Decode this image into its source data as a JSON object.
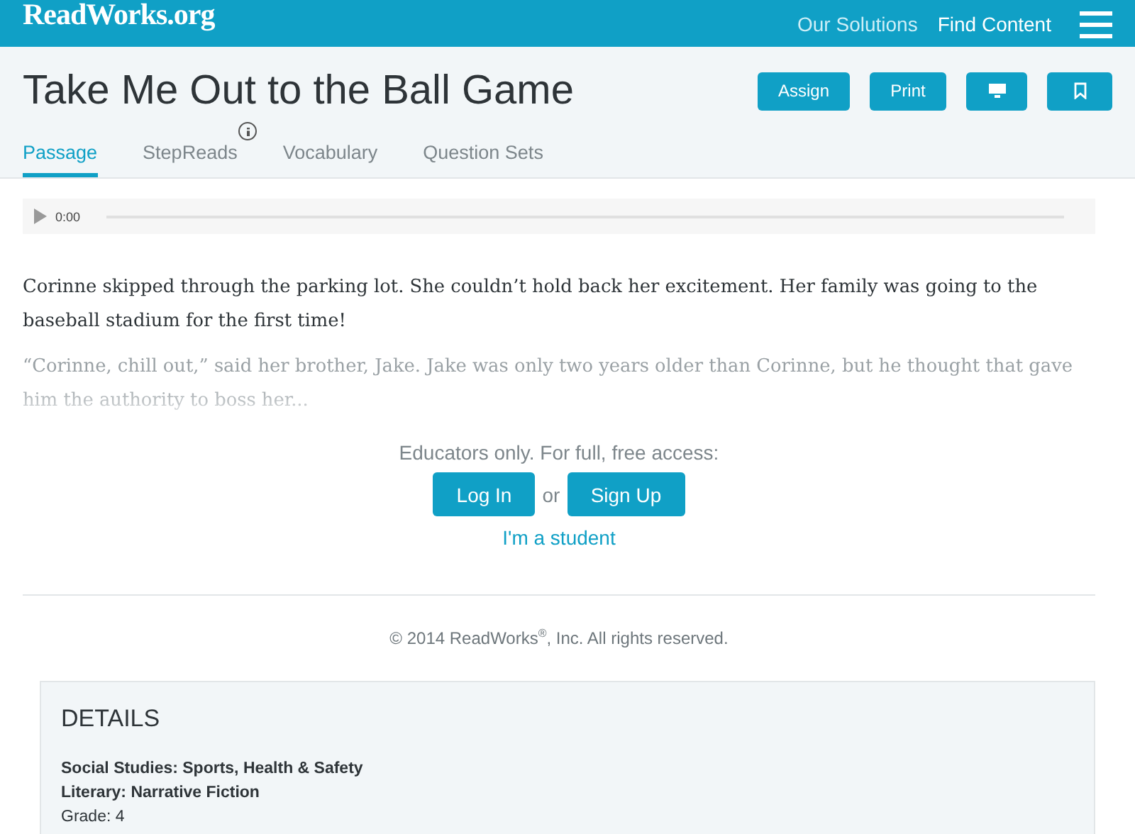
{
  "header": {
    "logo": "ReadWorks.org",
    "nav": [
      "Our Solutions",
      "Find Content"
    ]
  },
  "title": "Take Me Out to the Ball Game",
  "actions": [
    {
      "kind": "text",
      "label": "Assign"
    },
    {
      "kind": "text",
      "label": "Print"
    },
    {
      "kind": "monitor"
    },
    {
      "kind": "bookmark"
    }
  ],
  "tabs": [
    {
      "label": "Passage",
      "selected": true,
      "info": false
    },
    {
      "label": "StepReads",
      "selected": false,
      "info": true
    },
    {
      "label": "Vocabulary",
      "selected": false,
      "info": false
    },
    {
      "label": "Question Sets",
      "selected": false,
      "info": false
    }
  ],
  "audio": {
    "time": "0:00"
  },
  "paragraphs": [
    {
      "text": "Corinne skipped through the parking lot. She couldn’t hold back her excitement. Her family was going to the baseball stadium for the first time!",
      "faded": false
    },
    {
      "text": "“Corinne, chill out,” said her brother, Jake. Jake was only two years older than Corinne, but he thought that gave him the authority to boss her...",
      "faded": true
    }
  ],
  "access": {
    "prompt": "Educators only. For full, free access:",
    "login": "Log In",
    "or": "or",
    "signup": "Sign Up",
    "student": "I'm a student"
  },
  "copyright": "© 2014 ReadWorks$^{®}$, Inc. All rights reserved.",
  "details": {
    "heading": "DETAILS",
    "items": [
      {
        "text": "Social Studies: Sports, Health & Safety",
        "bold": true
      },
      {
        "text": "Literary: Narrative Fiction",
        "bold": true
      },
      {
        "text": "Grade: 4",
        "bold": false
      }
    ]
  }
}
